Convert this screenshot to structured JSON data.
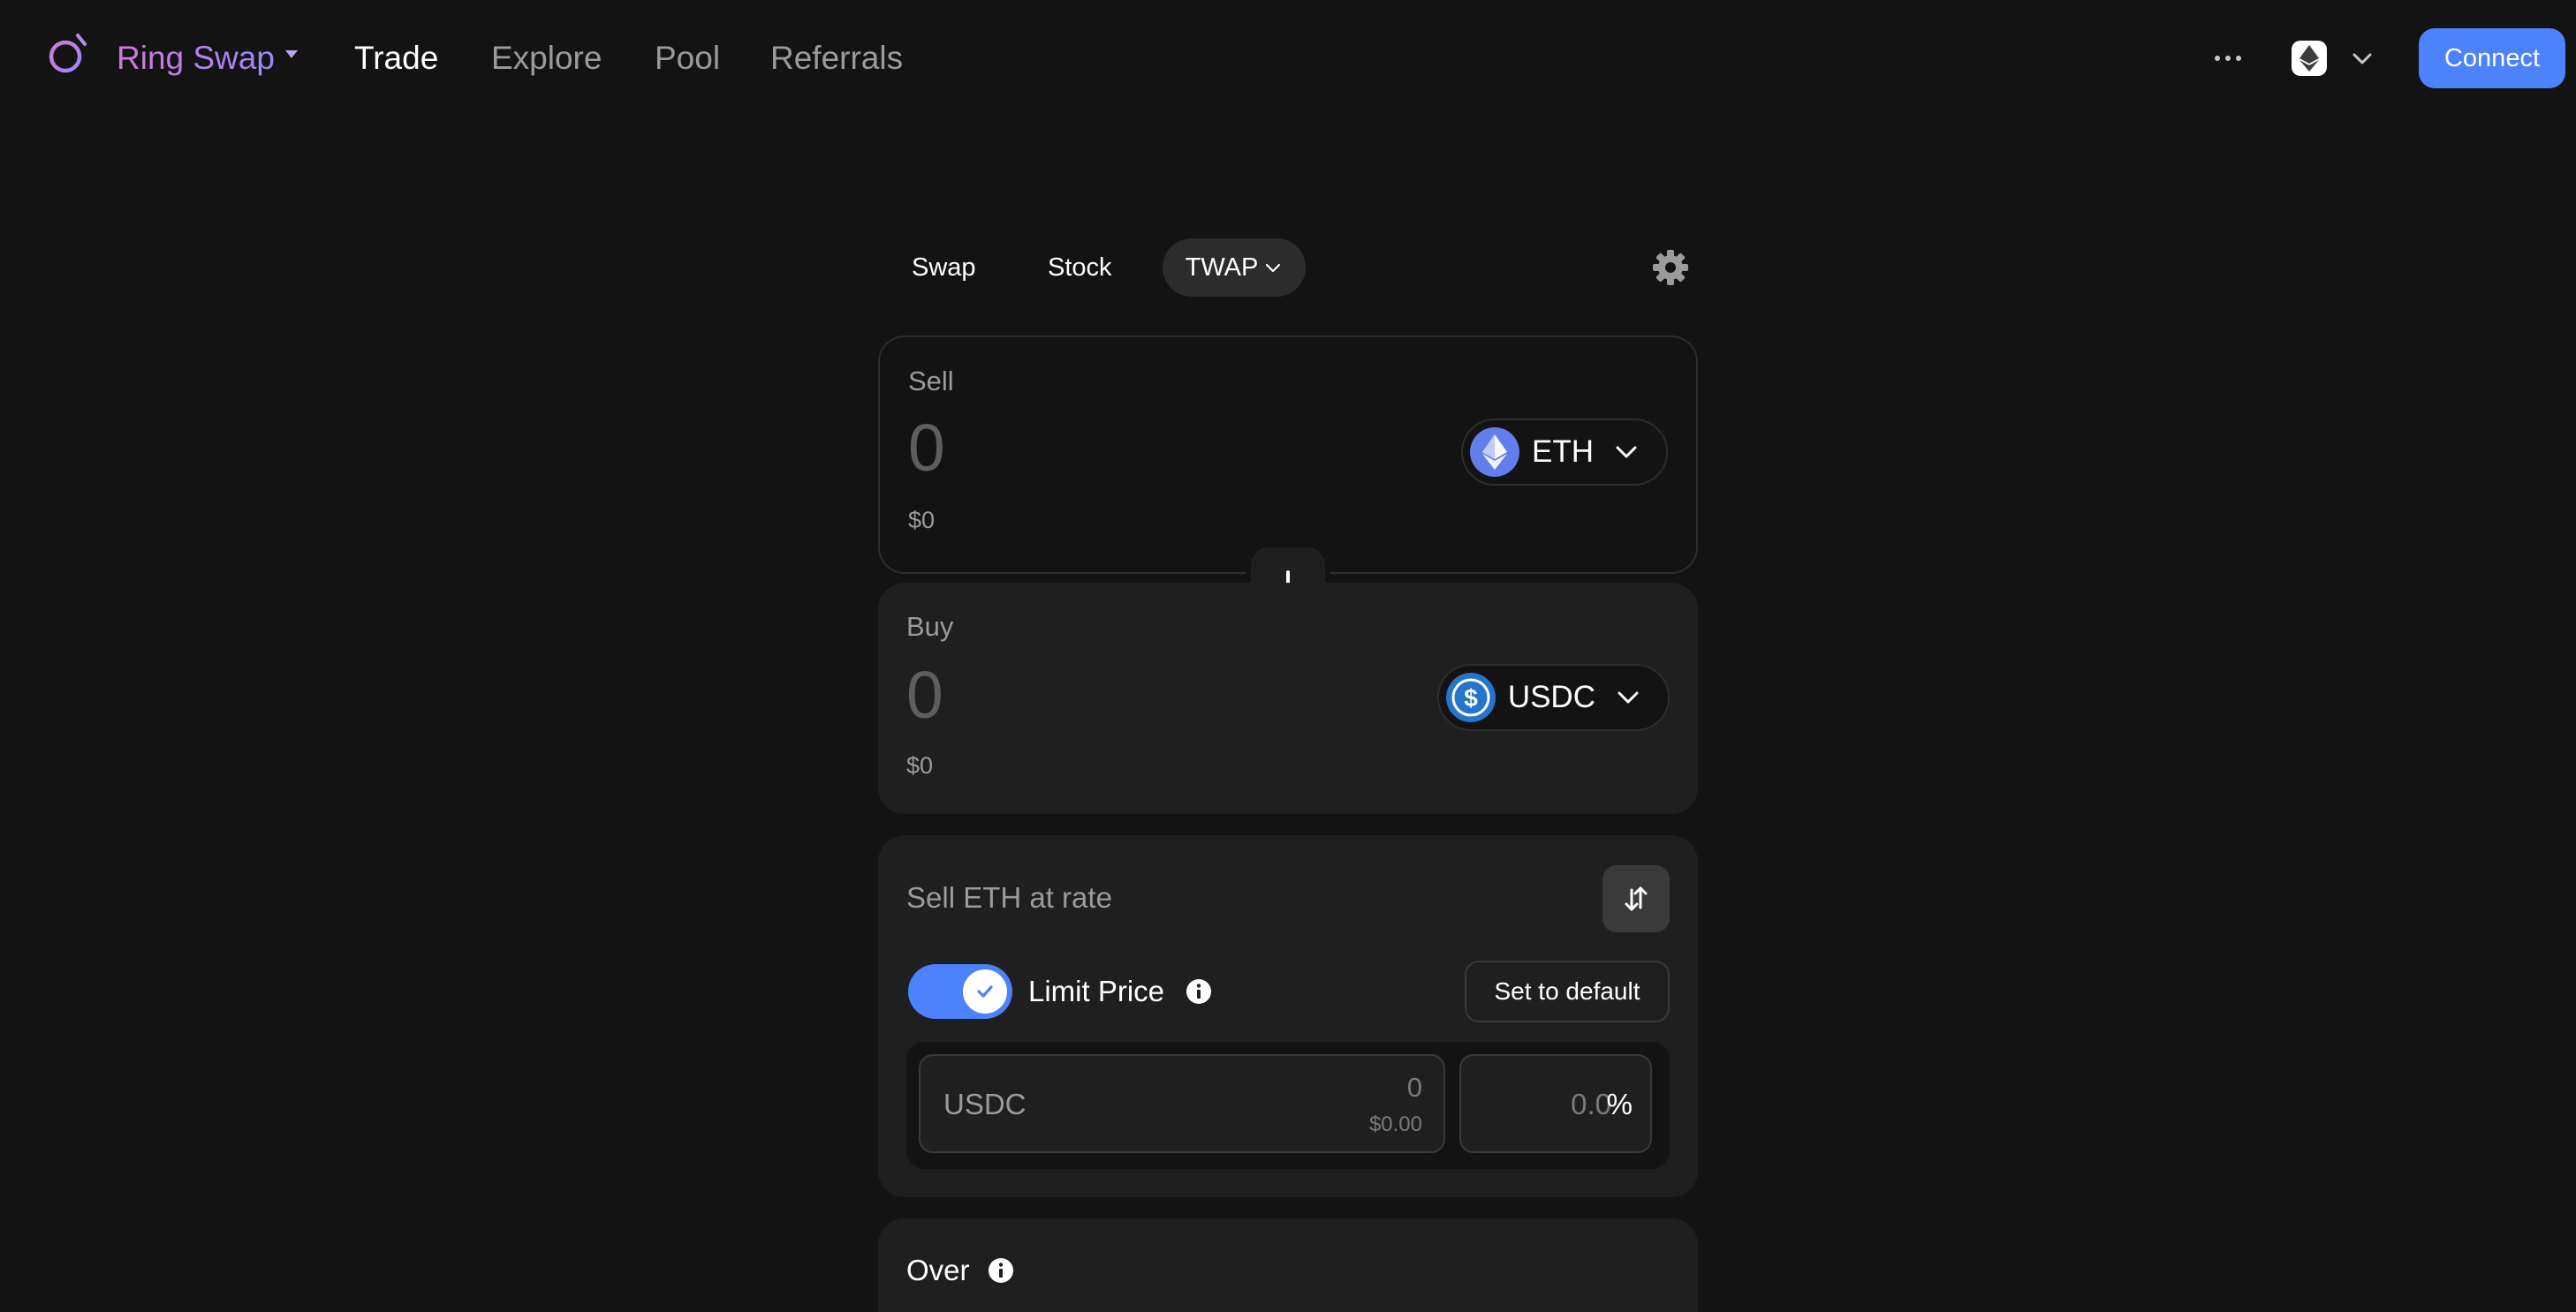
{
  "nav": {
    "brand": "Ring Swap",
    "links": [
      "Trade",
      "Explore",
      "Pool",
      "Referrals"
    ],
    "connect_label": "Connect"
  },
  "tabs": [
    "Swap",
    "Stock",
    "TWAP"
  ],
  "sell": {
    "label": "Sell",
    "amount_placeholder": "0",
    "usd": "$0",
    "token": "ETH"
  },
  "buy": {
    "label": "Buy",
    "amount_placeholder": "0",
    "usd": "$0",
    "token": "USDC"
  },
  "rate": {
    "title": "Sell ETH at rate",
    "limit_label": "Limit Price",
    "limit_enabled": true,
    "default_label": "Set to default",
    "unit": "USDC",
    "price_value": "0",
    "price_usd": "$0.00",
    "percent_value": "0.0",
    "percent_sign": "%"
  },
  "over": {
    "label": "Over"
  },
  "colors": {
    "background": "#131313",
    "panel": "#1f1f1f",
    "accent": "#4c82fb",
    "muted_text": "#9b9b9b",
    "brand_gradient_start": "#d17ad4",
    "brand_gradient_end": "#9b86ff"
  },
  "icons": [
    "ring-logo-icon",
    "more-icon",
    "ethereum-icon",
    "chevron-down-icon",
    "gear-icon",
    "arrow-down-icon",
    "usdc-icon",
    "invert-arrows-icon",
    "check-icon",
    "info-icon"
  ]
}
